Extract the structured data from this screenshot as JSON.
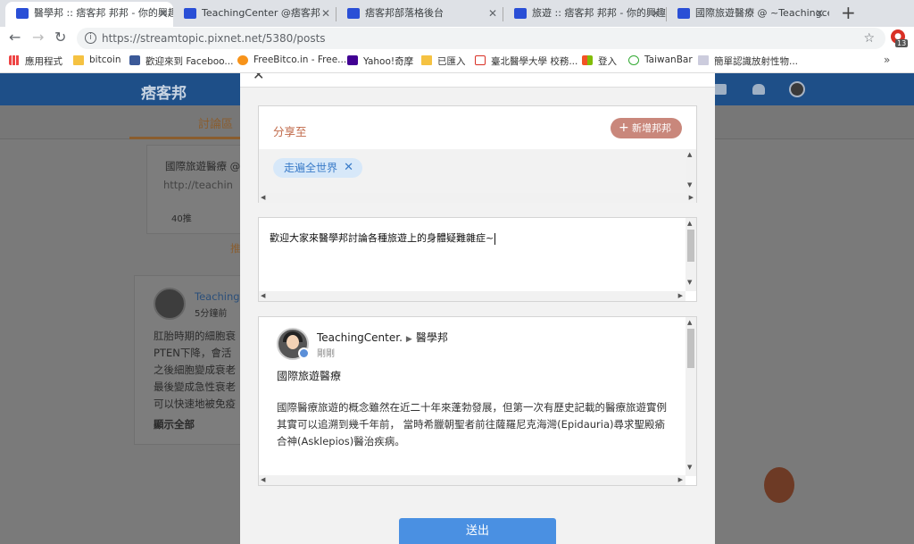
{
  "browser": {
    "tabs": [
      {
        "title": "醫學邦 :: 痞客邦 邦邦 - 你的興趣"
      },
      {
        "title": "TeachingCenter @痞客邦"
      },
      {
        "title": "痞客邦部落格後台"
      },
      {
        "title": "旅遊 :: 痞客邦 邦邦 - 你的興趣"
      },
      {
        "title": "國際旅遊醫療 @ ~Teachingce"
      }
    ],
    "url": "https://streamtopic.pixnet.net/5380/posts",
    "extension_badge": "13",
    "bookmarks": [
      {
        "label": "應用程式"
      },
      {
        "label": "bitcoin"
      },
      {
        "label": "歡迎來到 Faceboo..."
      },
      {
        "label": "FreeBitco.in - Free..."
      },
      {
        "label": "Yahoo!奇摩"
      },
      {
        "label": "已匯入"
      },
      {
        "label": "臺北醫學大學 校務..."
      },
      {
        "label": "登入"
      },
      {
        "label": "TaiwanBar"
      },
      {
        "label": "簡單認識放射性物..."
      }
    ]
  },
  "site": {
    "logo": "痞客邦",
    "subnav_tab": "討論區",
    "bg_card1_title": "國際旅遊醫療 @",
    "bg_card1_link": "http://teachin",
    "bg_card1_count": "40推",
    "bg_card1_action": "推",
    "bg_post_author": "Teaching",
    "bg_post_time": "5分鐘前",
    "bg_post_lines": [
      "肛胎時期的細胞衰",
      "PTEN下降，會活",
      "之後細胞變成衰老",
      "最後變成急性衰老",
      "可以快速地被免疫"
    ],
    "bg_show_all": "顯示全部"
  },
  "modal": {
    "share_label": "分享至",
    "add_group_label": "新增邦邦",
    "selected_tag": "走遍全世界",
    "message": "歡迎大家來醫學邦討論各種旅遊上的身體疑難雜症~",
    "post": {
      "author": "TeachingCenter.",
      "group": "醫學邦",
      "time": "剛剛",
      "title": "國際旅遊醫療",
      "body": "國際醫療旅遊的概念雖然在近二十年來蓬勃發展，但第一次有歷史記載的醫療旅遊實例其實可以追溯到幾千年前， 當時希臘朝聖者前往薩羅尼克海灣(Epidauria)尋求聖殿瘉合神(Asklepios)醫治疾病。"
    },
    "submit_label": "送出"
  }
}
